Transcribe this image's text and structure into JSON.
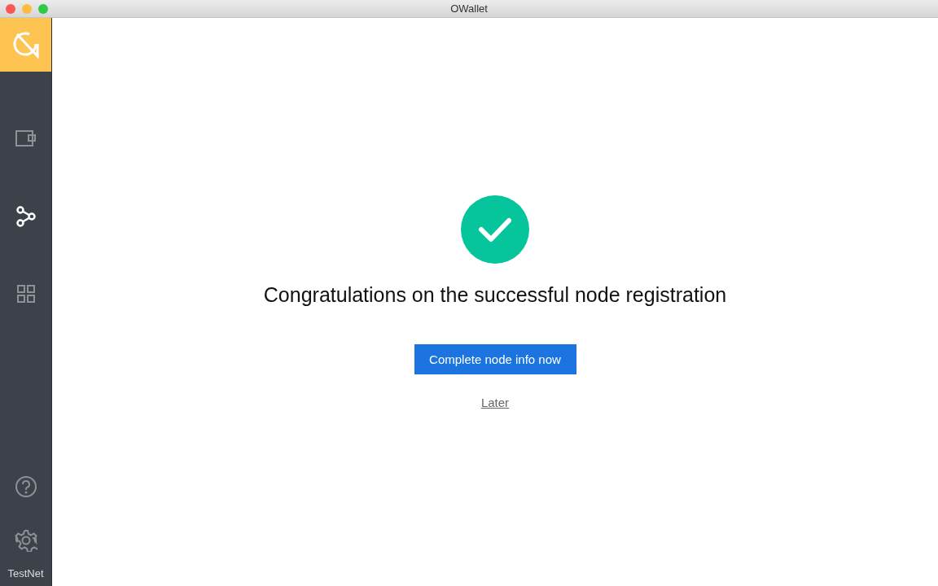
{
  "window": {
    "title": "OWallet"
  },
  "sidebar": {
    "items": [
      {
        "kind": "wallet",
        "selected": false
      },
      {
        "kind": "node",
        "selected": true
      },
      {
        "kind": "apps",
        "selected": false
      }
    ],
    "bottom_items": [
      {
        "kind": "help"
      },
      {
        "kind": "settings"
      }
    ],
    "network": "TestNet"
  },
  "result": {
    "heading": "Congratulations on the successful node registration",
    "primary_button": "Complete node info now",
    "secondary_link": "Later"
  }
}
